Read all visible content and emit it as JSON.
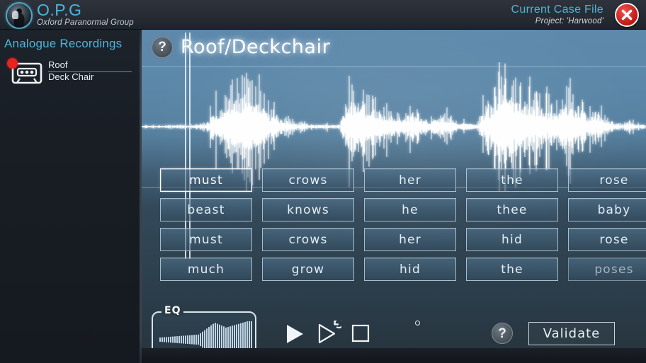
{
  "app": {
    "brand_name": "O.P.G",
    "brand_subtitle": "Oxford Paranormal Group",
    "logo_icon": "ghost-hand-logo-icon"
  },
  "header": {
    "case_title": "Current Case File",
    "case_project": "Project: 'Harwood'",
    "close_icon": "close-x-icon"
  },
  "sidebar": {
    "title": "Analogue Recordings",
    "recordings": [
      {
        "icon": "cassette-tape-icon",
        "badge_icon": "record-dot-icon",
        "line1": "Roof",
        "line2": "Deck Chair",
        "selected": true
      }
    ]
  },
  "main": {
    "help_icon": "question-mark-icon",
    "recording_title": "Roof/Deckchair",
    "waveform": {
      "playhead_x_pct": 8.5,
      "guide_lines": [
        3,
        50,
        96
      ]
    }
  },
  "word_grid": {
    "columns": 5,
    "rows": 4,
    "cells": [
      {
        "label": "must",
        "state": "selected"
      },
      {
        "label": "crows",
        "state": "normal"
      },
      {
        "label": "her",
        "state": "normal"
      },
      {
        "label": "the",
        "state": "normal"
      },
      {
        "label": "rose",
        "state": "normal"
      },
      {
        "label": "beast",
        "state": "normal"
      },
      {
        "label": "knows",
        "state": "normal"
      },
      {
        "label": "he",
        "state": "normal"
      },
      {
        "label": "thee",
        "state": "normal"
      },
      {
        "label": "baby",
        "state": "normal"
      },
      {
        "label": "must",
        "state": "normal"
      },
      {
        "label": "crows",
        "state": "normal"
      },
      {
        "label": "her",
        "state": "normal"
      },
      {
        "label": "hid",
        "state": "normal"
      },
      {
        "label": "rose",
        "state": "normal"
      },
      {
        "label": "much",
        "state": "normal"
      },
      {
        "label": "grow",
        "state": "normal"
      },
      {
        "label": "hid",
        "state": "normal"
      },
      {
        "label": "the",
        "state": "normal"
      },
      {
        "label": "poses",
        "state": "dim"
      }
    ]
  },
  "toolbar": {
    "eq_label": "EQ",
    "play_icon": "play-triangle-icon",
    "loop_play_icon": "loop-play-icon",
    "stop_icon": "stop-square-icon",
    "indicator_icon": "status-dot-icon",
    "help_icon": "question-mark-icon",
    "validate_label": "Validate"
  },
  "colors": {
    "accent_cyan": "#4fb4d8",
    "panel_blue": "#5e89ab",
    "panel_slate": "#27353f",
    "record_red": "#e8231f",
    "text_light": "#e9eef2"
  }
}
